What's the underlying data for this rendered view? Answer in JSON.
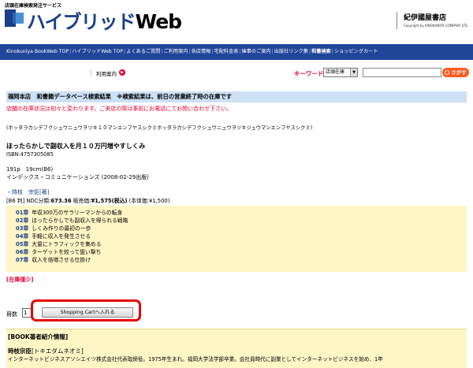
{
  "header": {
    "service_label": "店頭在庫検索発注サービス",
    "logo_main": "ハイブリッド",
    "logo_web": "Web",
    "company_name": "紀伊國屋書店",
    "company_copyright": "Copyright by KINOKUNIYA COMPANY LTD."
  },
  "nav": {
    "items": [
      "Kinokuniya BookWeb TOP",
      "ハイブリッドWeb TOP",
      "よくあるご質問",
      "ご利用案内",
      "各店情報",
      "宅配料金表",
      "催事のご案内",
      "出版社リンク集",
      "和書検索",
      "ショッピングカート"
    ],
    "current_index": 8
  },
  "search": {
    "guide_link": "利用案内",
    "keyword_label": "キーワード検索",
    "select_value": "店頭在庫",
    "input_value": "",
    "button_label": "さがす"
  },
  "store": {
    "title": "福岡本店　和書籍データベース検索結果　※検索結果は、前日の営業終了時の在庫です",
    "notice": "店舗の在庫状況は刻々と変わります。ご来店の際は事前にお電話にてお問い合わせ下さい。"
  },
  "book": {
    "kana": "(ホッタラカシデフクシュウニュウヲツキ１０マンエンフヤスシクミホッタラカシデフクシュウニュウヲツキジュウマンエンフヤスシクミ)",
    "title": "ほったらかしで副収入を月１０万円増やすしくみ",
    "isbn": "ISBN:4757305085",
    "pages": "191p　19cm(B6)",
    "publisher": "インデックス・コミュニケーションズ (2008-02-29出版)",
    "author_prefix": "・",
    "author": "時枝　宗臣[著]",
    "price_prefix": "[B6 判] NDC分類:",
    "ndc": "673.36",
    "price_mid": " 販売価:",
    "price_tax": "¥1,575(税込)",
    "price_suffix": " (本体価:¥1,500)",
    "chapters": [
      {
        "no": "01章",
        "title": "年収300万のサラリーマンからの転身"
      },
      {
        "no": "02章",
        "title": "ほったらかしでも副収入を得られる戦略"
      },
      {
        "no": "03章",
        "title": "しくみ作りの最初の一歩"
      },
      {
        "no": "04章",
        "title": "手軽に収入を発生させる"
      },
      {
        "no": "05章",
        "title": "大量にトラフィックを集める"
      },
      {
        "no": "06章",
        "title": "ターゲットを絞って狙い撃ち"
      },
      {
        "no": "07章",
        "title": "収入を倍増させる仕掛け"
      }
    ],
    "stock_status": "[在庫僅少]"
  },
  "cart": {
    "qty_label": "冊数",
    "qty_value": "1",
    "button_label": "Shopping Cartへ入れる"
  },
  "author_info": {
    "box_title": "[BOOK著者紹介情報]",
    "name": "時枝宗臣",
    "reading": "[トキエダムネオミ]",
    "bio": "インターネットビジネスアソシエイツ株式会社代表取締役。1975年生まれ。福岡大学法学部卒業。会社員時代に副業としてインターネットビジネスを始め、1年"
  },
  "colors": {
    "nav_bg": "#20469a",
    "store_bar_bg": "#cde0f4",
    "accent_red": "#e60033",
    "chapter_bg": "#fff6c6",
    "search_button": "#ff5a1e"
  }
}
